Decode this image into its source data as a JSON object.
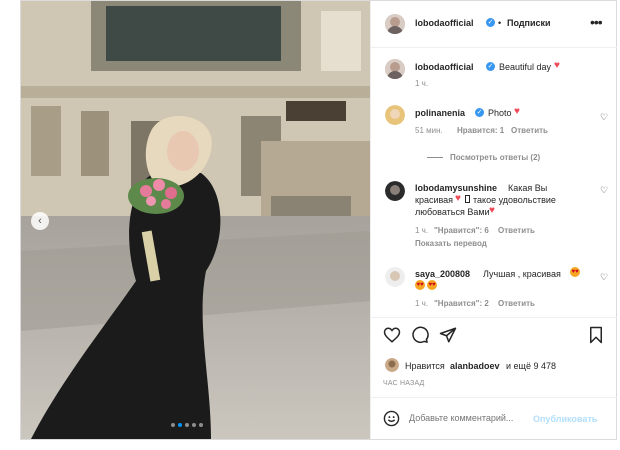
{
  "header": {
    "username": "lobodaofficial",
    "separator": "•",
    "follow_label": "Подписки",
    "more_icon": "more-horizontal-icon"
  },
  "caption": {
    "username": "lobodaofficial",
    "text": "Beautiful day",
    "time": "1 ч."
  },
  "comments": [
    {
      "username": "polinanenia",
      "text": "Photo",
      "time": "51 мин.",
      "likes": "Нравится: 1",
      "reply": "Ответить"
    },
    {
      "username": "lobodamysunshine",
      "text_line1": "Какая Вы",
      "text_line2": "красивая",
      "text_line3": "такое удовольствие",
      "text_line4": "любоваться Вами",
      "time": "1 ч.",
      "likes": "\"Нравится\": 6",
      "reply": "Ответить",
      "translate": "Показать перевод"
    },
    {
      "username": "saya_200808",
      "text": "Лучшая , красивая",
      "time": "1 ч.",
      "likes": "\"Нравится\": 2",
      "reply": "Ответить"
    }
  ],
  "view_replies": "Посмотреть ответы (2)",
  "likes_summary": {
    "prefix": "Нравится",
    "user": "alanbadoev",
    "suffix": "и ещё 9 478"
  },
  "time_ago": "ЧАС НАЗАД",
  "add_comment": {
    "placeholder": "Добавьте комментарий...",
    "publish": "Опубликовать"
  },
  "colors": {
    "link_blue": "#0095f6",
    "heart_red": "#ed4956",
    "verified_blue": "#3897f0"
  },
  "carousel": {
    "dots": 5,
    "active": 1
  }
}
